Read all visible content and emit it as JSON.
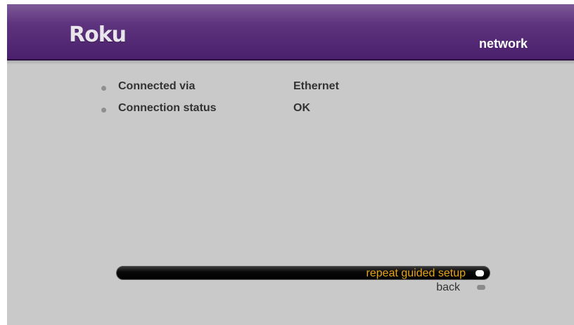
{
  "header": {
    "logo": "Roku",
    "section_title": "network"
  },
  "info": [
    {
      "label": "Connected via",
      "value": "Ethernet"
    },
    {
      "label": "Connection status",
      "value": "OK"
    }
  ],
  "menu": {
    "items": [
      {
        "label": "repeat guided setup",
        "selected": true
      },
      {
        "label": "back",
        "selected": false
      }
    ]
  },
  "colors": {
    "header_purple": "#5e347f",
    "background_gray": "#c9c9c9",
    "selected_text": "#e8a317",
    "text_dark": "#333333"
  }
}
